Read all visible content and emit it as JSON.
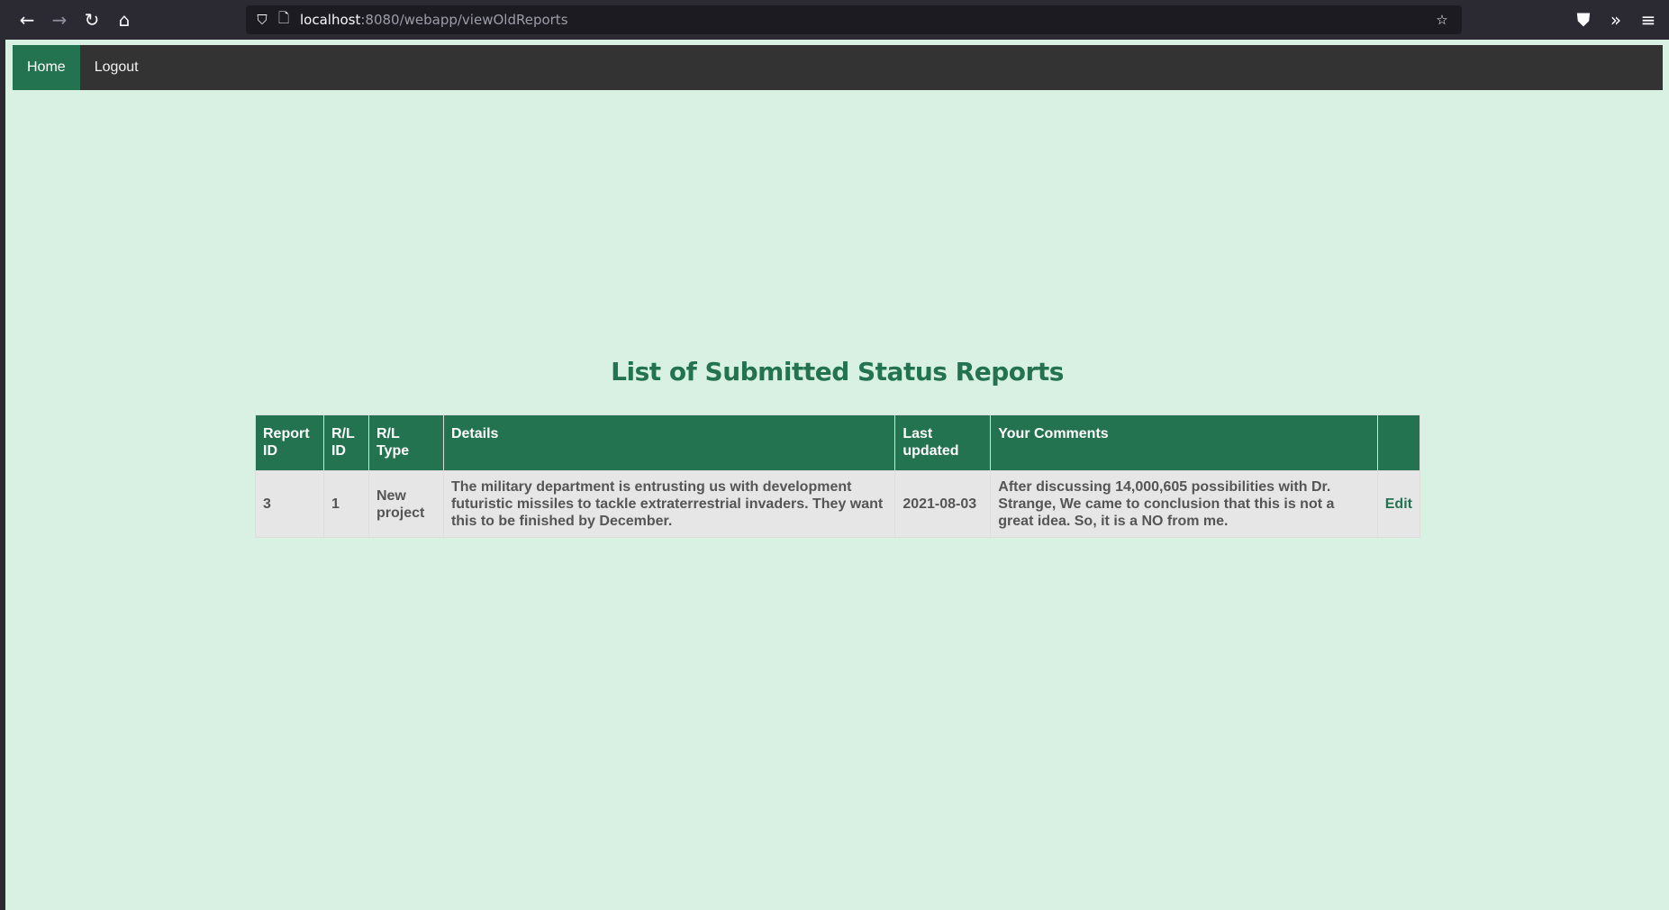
{
  "browser": {
    "url_host": "localhost",
    "url_path": ":8080/webapp/viewOldReports"
  },
  "nav": {
    "home_label": "Home",
    "logout_label": "Logout"
  },
  "page": {
    "title": "List of Submitted Status Reports"
  },
  "table": {
    "headers": [
      "Report ID",
      "R/L ID",
      "R/L Type",
      "Details",
      "Last updated",
      "Your Comments",
      ""
    ],
    "rows": [
      {
        "report_id": "3",
        "rl_id": "1",
        "rl_type": "New project",
        "details": "The military department is entrusting us with development futuristic missiles to tackle extraterrestrial invaders. They want this to be finished by December.",
        "last_updated": "2021-08-03",
        "comments": "After discussing 14,000,605 possibilities with Dr. Strange, We came to conclusion that this is not a great idea. So, it is a NO from me.",
        "action": "Edit"
      }
    ]
  },
  "colors": {
    "accent": "#247350",
    "page_bg": "#d8f1e3",
    "nav_bg": "#333333"
  }
}
